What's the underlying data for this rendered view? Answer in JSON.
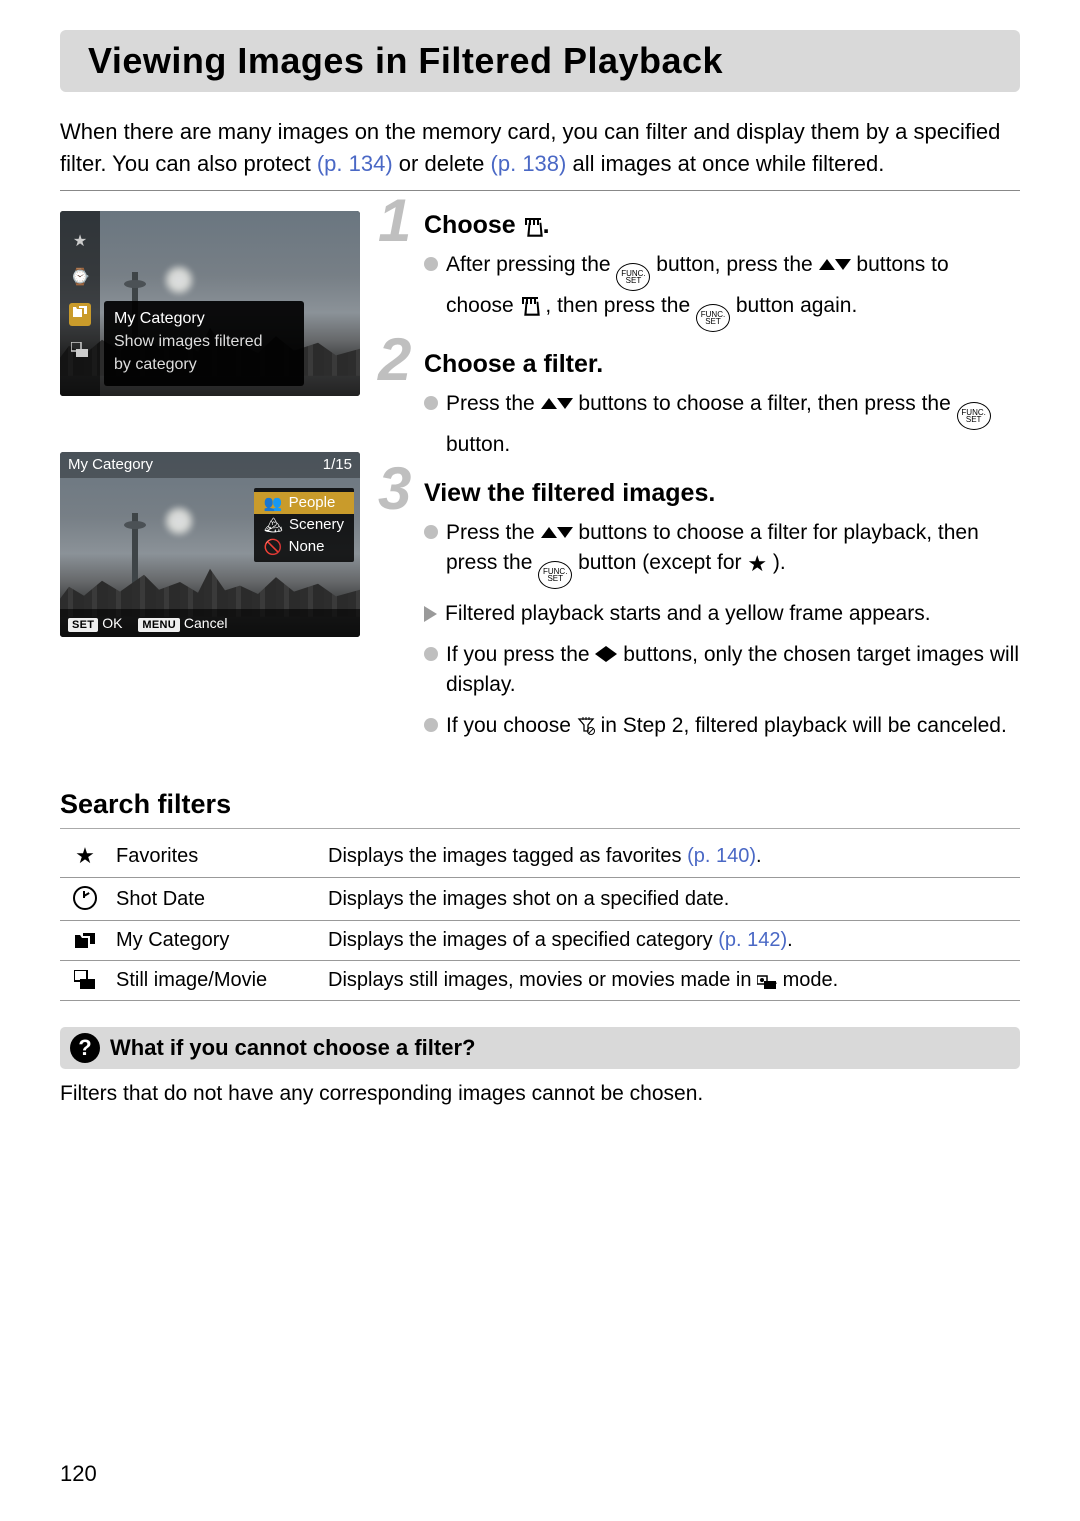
{
  "page_number": "120",
  "title": "Viewing Images in Filtered Playback",
  "intro": {
    "part1": "When there are many images on the memory card, you can filter and display them by a specified filter. You can also protect ",
    "link1": "(p. 134)",
    "part2": " or delete ",
    "link2": "(p. 138)",
    "part3": " all images at once while filtered."
  },
  "screenshot1": {
    "my_category": "My Category",
    "desc_line1": "Show images filtered",
    "desc_line2": "by category"
  },
  "screenshot2": {
    "title": "My Category",
    "count": "1/15",
    "opt1": "People",
    "opt2": "Scenery",
    "opt3": "None",
    "set": "SET",
    "ok": "OK",
    "menu": "MENU",
    "cancel": "Cancel"
  },
  "steps": {
    "s1": {
      "num": "1",
      "head_prefix": "Choose ",
      "head_suffix": ".",
      "b1a": "After pressing the ",
      "b1b": " button, press the ",
      "b1c": " buttons to choose ",
      "b1d": ", then press the ",
      "b1e": " button again."
    },
    "s2": {
      "num": "2",
      "head": "Choose a filter.",
      "b1a": "Press the ",
      "b1b": " buttons to choose a filter, then press the ",
      "b1c": " button."
    },
    "s3": {
      "num": "3",
      "head": "View the filtered images.",
      "b1a": "Press the ",
      "b1b": " buttons to choose a filter for playback, then press the ",
      "b1c": " button (except for ",
      "b1d": ").",
      "b2": "Filtered playback starts and a yellow frame appears.",
      "b3a": "If you press the ",
      "b3b": " buttons, only the chosen target images will display.",
      "b4a": "If you choose ",
      "b4b": " in Step 2, filtered playback will be canceled."
    }
  },
  "search_filters_heading": "Search filters",
  "filters": {
    "r1": {
      "name": "Favorites",
      "desc_a": "Displays the images tagged as favorites ",
      "link": "(p. 140)",
      "desc_b": "."
    },
    "r2": {
      "name": "Shot Date",
      "desc": "Displays the images shot on a specified date."
    },
    "r3": {
      "name": "My Category",
      "desc_a": "Displays the images of a specified category ",
      "link": "(p. 142)",
      "desc_b": "."
    },
    "r4": {
      "name": "Still image/Movie",
      "desc_a": "Displays still images, movies or movies made in ",
      "desc_b": " mode."
    }
  },
  "qbox": {
    "title": "What if you cannot choose a filter?",
    "body": "Filters that do not have any corresponding images cannot be chosen."
  }
}
